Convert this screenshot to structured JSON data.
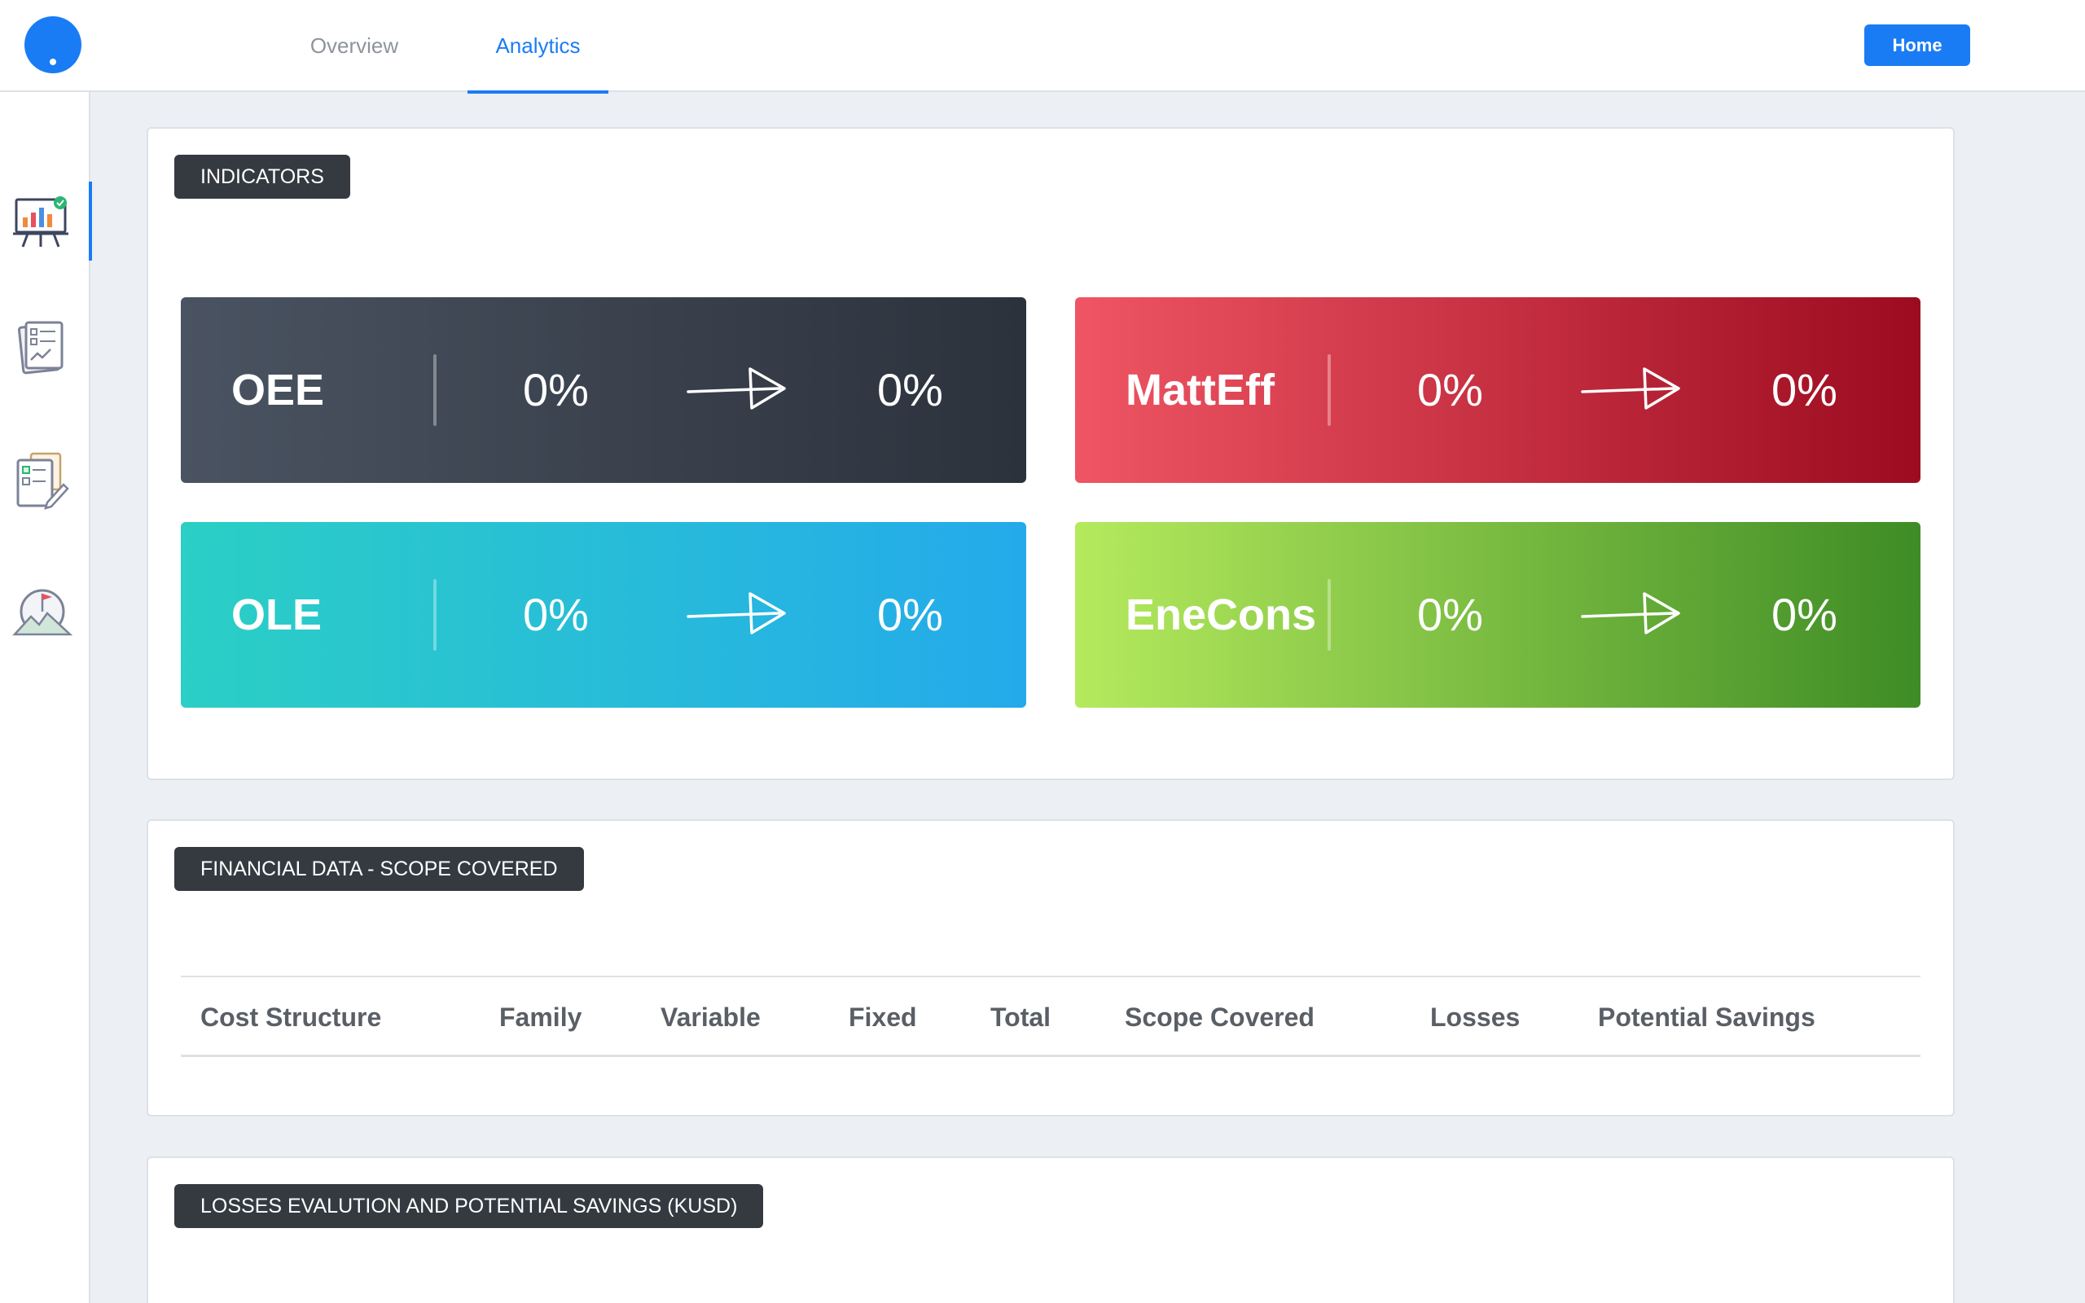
{
  "header": {
    "tabs": [
      {
        "label": "Overview"
      },
      {
        "label": "Analytics"
      }
    ],
    "home_label": "Home"
  },
  "sidebar": {
    "items": [
      {
        "icon": "presentation-chart-icon"
      },
      {
        "icon": "report-checklist-icon"
      },
      {
        "icon": "checklist-edit-icon"
      },
      {
        "icon": "mountain-flag-icon"
      }
    ]
  },
  "indicators": {
    "title": "INDICATORS",
    "cards": [
      {
        "name": "OEE",
        "from": "0%",
        "to": "0%"
      },
      {
        "name": "MattEff",
        "from": "0%",
        "to": "0%"
      },
      {
        "name": "OLE",
        "from": "0%",
        "to": "0%"
      },
      {
        "name": "EneCons",
        "from": "0%",
        "to": "0%"
      }
    ]
  },
  "financial": {
    "title": "FINANCIAL DATA - SCOPE COVERED",
    "columns": [
      "Cost Structure",
      "Family",
      "Variable",
      "Fixed",
      "Total",
      "Scope Covered",
      "Losses",
      "Potential Savings"
    ]
  },
  "losses": {
    "title": "LOSSES EVALUTION AND POTENTIAL SAVINGS (KUSD)"
  }
}
